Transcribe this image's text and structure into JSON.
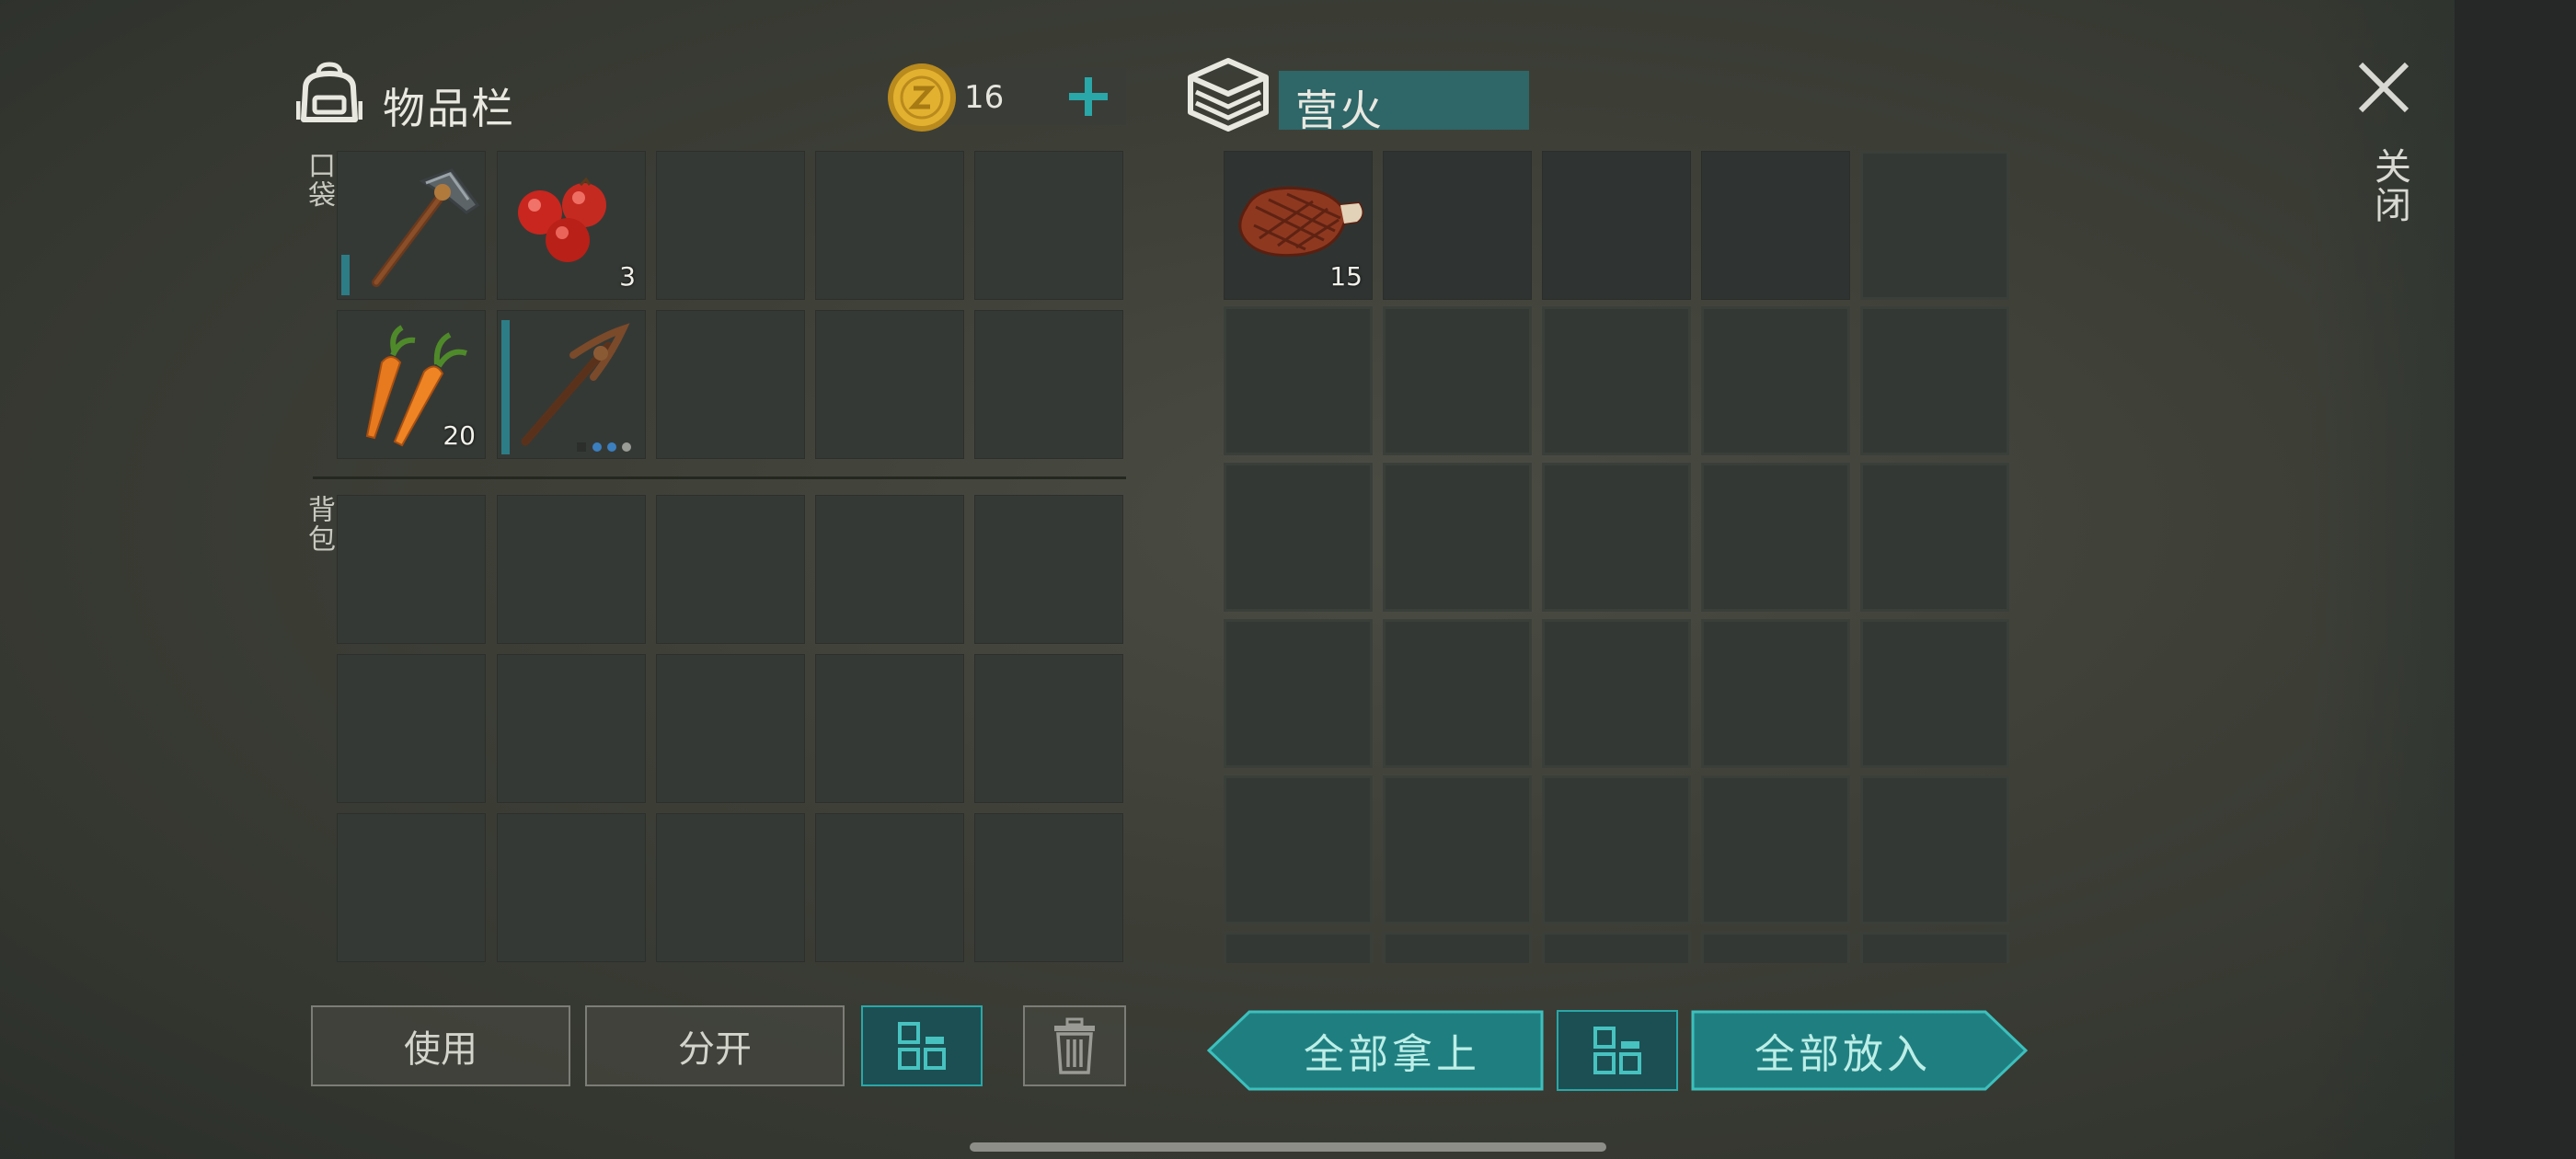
{
  "header": {
    "inventory_title": "物品栏",
    "coin_count": "16",
    "container_name": "营火",
    "close_label": "关闭"
  },
  "sections": {
    "pocket_label": "口袋",
    "backpack_label": "背包"
  },
  "pocket_items": [
    {
      "slot": 0,
      "item": "hammer",
      "durability": 0.28
    },
    {
      "slot": 1,
      "item": "berries",
      "count": "3"
    },
    {
      "slot": 5,
      "item": "carrots",
      "count": "20"
    },
    {
      "slot": 6,
      "item": "pickaxe",
      "durability": 0.95
    }
  ],
  "container_items": [
    {
      "slot": 0,
      "item": "steak",
      "count": "15"
    }
  ],
  "buttons": {
    "use": "使用",
    "split": "分开",
    "take_all": "全部拿上",
    "put_all": "全部放入"
  },
  "colors": {
    "accent_teal": "#2aa7a8",
    "teal_fill": "#1b4f53",
    "coin_gold": "#e2b12f"
  }
}
